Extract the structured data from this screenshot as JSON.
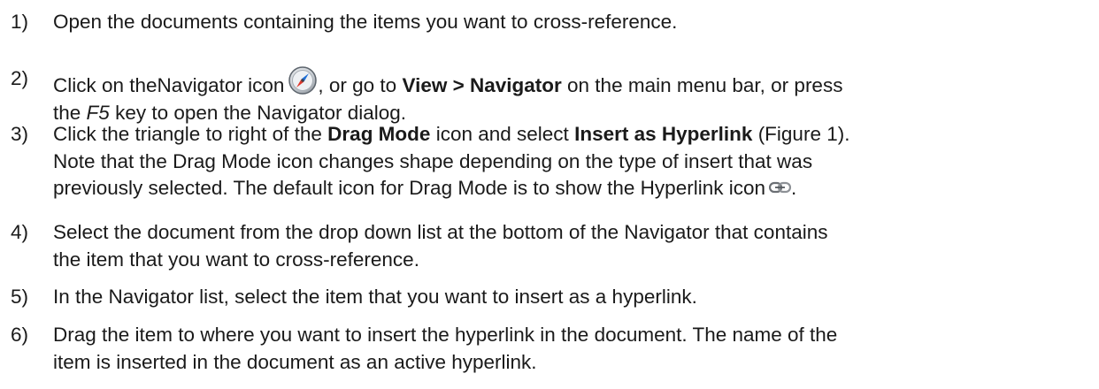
{
  "steps": [
    {
      "number": "1)",
      "line1": "Open the documents containing the items you want to cross-reference."
    },
    {
      "number": "2)",
      "l1a": "Click on theNavigator icon",
      "l1b": ", or go to",
      "l1bold": "View > Navigator",
      "l1c": "on the main menu bar, or press",
      "l2a": "the",
      "l2italic": "F5",
      "l2b": "key to open the Navigator dialog.",
      "icon": "navigator-compass-icon"
    },
    {
      "number": "3)",
      "l1a": "Click the triangle to right of the",
      "l1bold1": "Drag Mode",
      "l1b": "icon and select",
      "l1bold2": "Insert as Hyperlink",
      "l1c": "(Figure 1).",
      "line2": "Note that the Drag Mode icon changes shape depending on the type of insert that was",
      "line3": "previously selected. The default icon for Drag Mode is to show the Hyperlink icon",
      "line3end": ".",
      "icon": "hyperlink-chain-icon"
    },
    {
      "number": "4)",
      "line1": "Select the document from the drop down list at the bottom of the Navigator that contains",
      "line2": "the item that you want to cross-reference."
    },
    {
      "number": "5)",
      "line1": "In the Navigator list, select the item that you want to insert as a hyperlink."
    },
    {
      "number": "6)",
      "line1": "Drag the item to where you want to insert the hyperlink in the document. The name of the",
      "line2": "item is inserted in the document as an active hyperlink."
    }
  ]
}
